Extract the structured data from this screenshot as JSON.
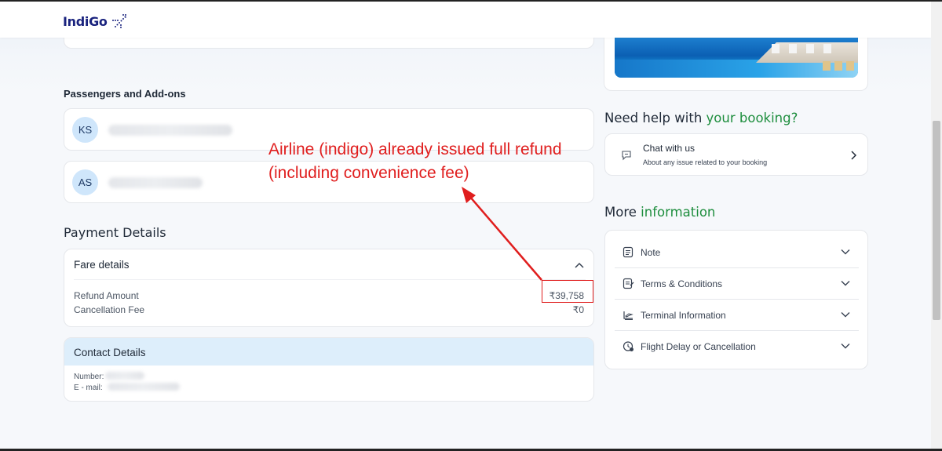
{
  "header": {
    "logo_text": "IndiGo",
    "brand_color": "#1a237e"
  },
  "passengers": {
    "section_title": "Passengers and Add-ons",
    "items": [
      {
        "initials": "KS"
      },
      {
        "initials": "AS"
      }
    ]
  },
  "annotation": {
    "line1": "Airline (indigo) already issued full refund",
    "line2": "(including convenience fee)",
    "color": "#e01e1e"
  },
  "payment": {
    "section_title": "Payment Details",
    "fare_title": "Fare details",
    "rows": [
      {
        "label": "Refund Amount",
        "value": "₹39,758"
      },
      {
        "label": "Cancellation Fee",
        "value": "₹0"
      }
    ]
  },
  "contact": {
    "title": "Contact Details",
    "number_label": "Number:",
    "email_label": "E - mail:"
  },
  "help": {
    "title_prefix": "Need help with ",
    "title_accent": "your booking?",
    "chat_title": "Chat with us",
    "chat_subtitle": "About any issue related to your booking"
  },
  "more": {
    "title_prefix": "More ",
    "title_accent": "information",
    "accent_color": "#1e8e3e",
    "items": [
      {
        "label": "Note",
        "icon": "note-icon"
      },
      {
        "label": "Terms & Conditions",
        "icon": "terms-icon"
      },
      {
        "label": "Terminal Information",
        "icon": "terminal-icon"
      },
      {
        "label": "Flight Delay or Cancellation",
        "icon": "flight-delay-icon"
      }
    ]
  }
}
